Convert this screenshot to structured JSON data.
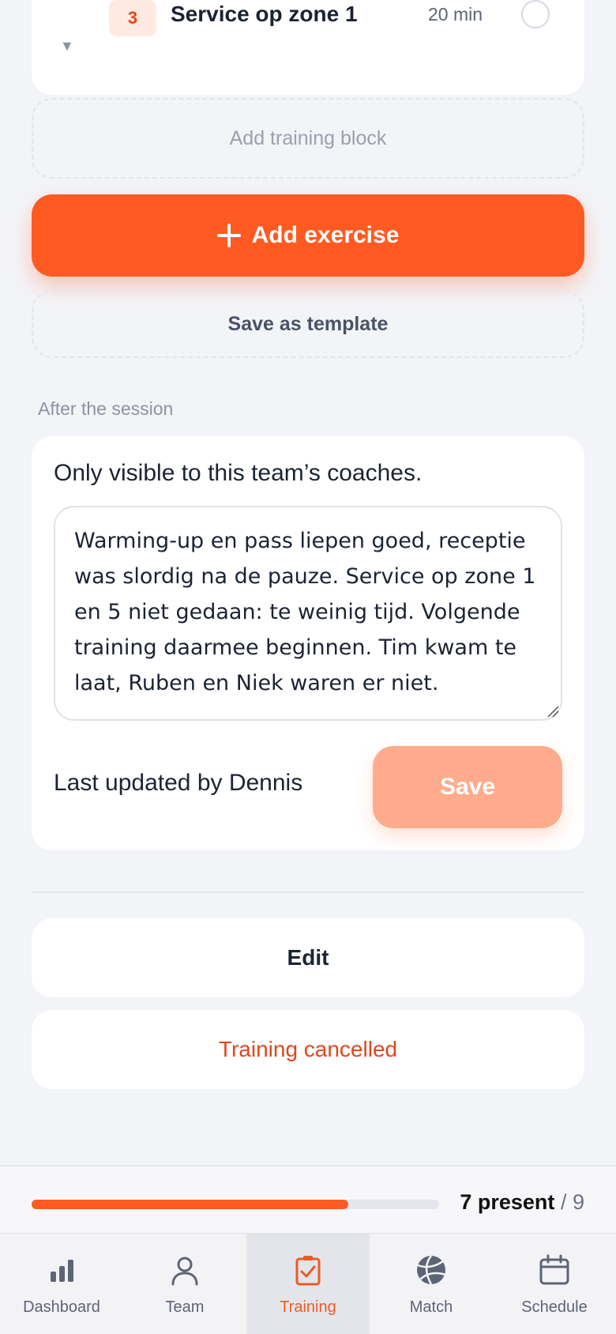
{
  "exercise": {
    "number": "3",
    "title": "Service op zone 1",
    "duration": "20 min"
  },
  "actions": {
    "add_block_label": "Add training block",
    "add_exercise_label": "Add exercise",
    "save_template_label": "Save as template"
  },
  "after_session": {
    "section_label": "After the session",
    "visibility_hint": "Only visible to this team’s coaches.",
    "notes": "Warming-up en pass liepen goed, receptie was slordig na de pauze. Service op zone 1 en 5 niet gedaan: te weinig tijd. Volgende training daarmee beginnen. Tim kwam te laat, Ruben en Niek waren er niet.",
    "last_updated": "Last updated by Dennis",
    "save_label": "Save"
  },
  "session_buttons": {
    "edit_label": "Edit",
    "cancelled_label": "Training cancelled"
  },
  "attendance": {
    "present_label": "7 present",
    "separator": "/",
    "total": "9",
    "present_fraction": 0.778
  },
  "nav": {
    "items": [
      {
        "label": "Dashboard",
        "icon": "bar-chart-icon",
        "active": false
      },
      {
        "label": "Team",
        "icon": "person-icon",
        "active": false
      },
      {
        "label": "Training",
        "icon": "clipboard-check-icon",
        "active": true
      },
      {
        "label": "Match",
        "icon": "volleyball-icon",
        "active": false
      },
      {
        "label": "Schedule",
        "icon": "calendar-icon",
        "active": false
      }
    ]
  },
  "colors": {
    "accent": "#ff5a22",
    "accent_light": "#ffab8c",
    "danger_text": "#e0471a",
    "background": "#f3f4f8"
  }
}
